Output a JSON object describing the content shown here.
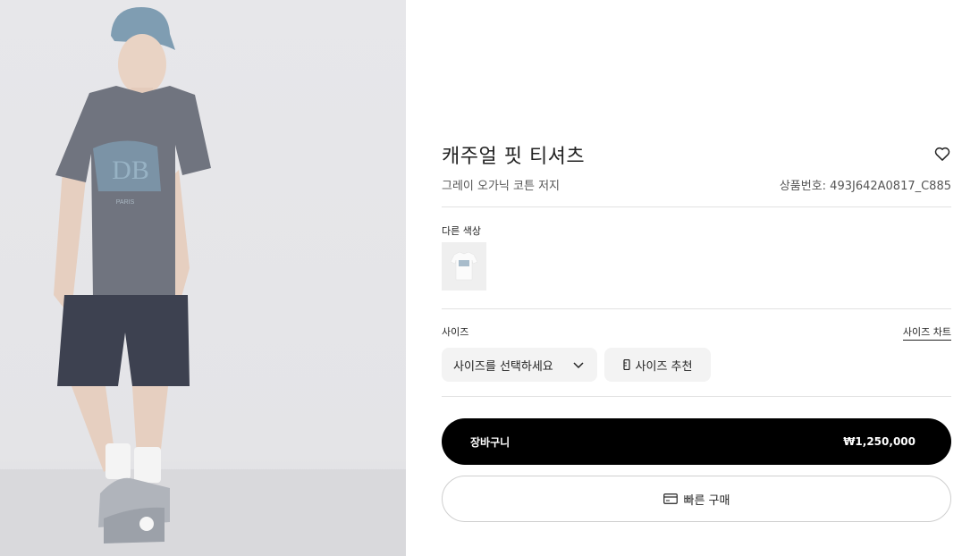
{
  "product": {
    "title": "캐주얼 핏 티셔츠",
    "subtitle": "그레이 오가닉 코튼 저지",
    "code_label": "상품번호: ",
    "code_value": "493J642A0817_C885"
  },
  "icons": {
    "wishlist": "heart-icon",
    "dropdown": "chevron-down-icon",
    "size_reco": "ruler-icon",
    "quick_buy": "credit-card-icon"
  },
  "colors": {
    "label": "다른 색상",
    "swatches": [
      {
        "name": "white-tshirt-swatch"
      }
    ]
  },
  "size": {
    "label": "사이즈",
    "chart_link": "사이즈 차트",
    "select_placeholder": "사이즈를 선택하세요",
    "recommend_label": "사이즈 추천"
  },
  "actions": {
    "cart_label": "장바구니",
    "price": "₩1,250,000",
    "quick_buy_label": "빠른 구매"
  },
  "theme": {
    "primary": "#000000",
    "button_bg": "#f3f3f3",
    "divider": "#e2e2e2"
  }
}
